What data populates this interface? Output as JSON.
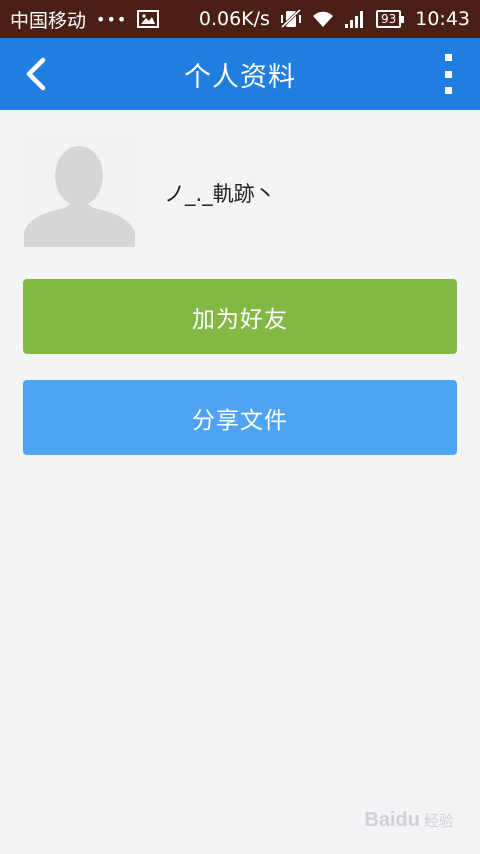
{
  "status_bar": {
    "carrier": "中国移动",
    "dots": "•••",
    "speed": "0.06K/s",
    "battery": "93",
    "time": "10:43"
  },
  "header": {
    "title": "个人资料"
  },
  "profile": {
    "nickname": "ノ_._軌跡丶"
  },
  "actions": {
    "add_friend_label": "加为好友",
    "share_file_label": "分享文件"
  },
  "watermark": {
    "brand": "Baidu",
    "sub": "经验"
  },
  "colors": {
    "status_bar_bg": "#4a1f16",
    "title_bar_bg": "#1f7ee0",
    "add_friend_bg": "#83b844",
    "share_file_bg": "#4ea3f5",
    "page_bg": "#f3f4f6"
  }
}
